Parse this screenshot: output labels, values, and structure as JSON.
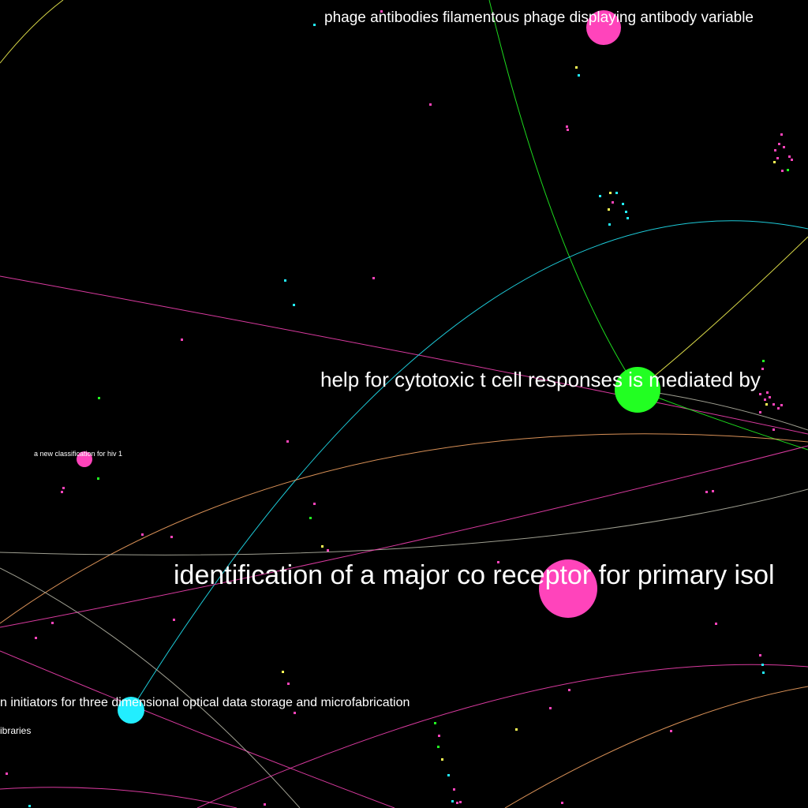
{
  "colors": {
    "background": "#000000",
    "pink": "#ff44bb",
    "green": "#22ff22",
    "cyan": "#22eeff",
    "yellow": "#ffff55",
    "orange": "#ffaa66",
    "gray": "#bbbbaa",
    "label": "#ffffff"
  },
  "labels": {
    "phage": "phage antibodies filamentous phage displaying antibody variable",
    "help": "help for cytotoxic t cell responses is mediated by",
    "classification": "a new classification for hiv 1",
    "corec": "identification of a major co receptor for primary isol",
    "initiators": "n initiators for three dimensional optical data storage and microfabrication",
    "libraries": "ibraries"
  }
}
